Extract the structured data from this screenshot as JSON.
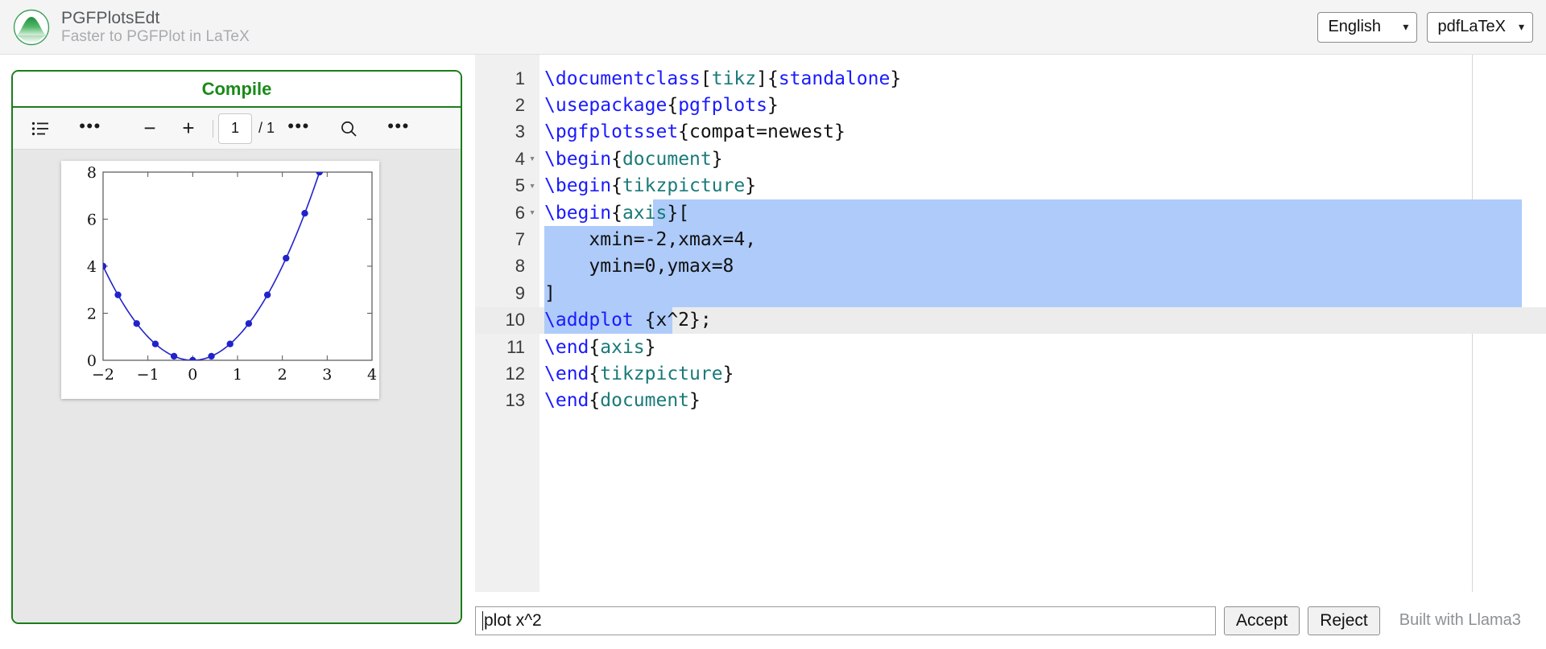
{
  "header": {
    "logo_icon": "pgfplots-peak-logo",
    "title": "PGFPlotsEdt",
    "subtitle": "Faster to PGFPlot in LaTeX",
    "language_select": {
      "value": "English",
      "chevron": "⌄"
    },
    "engine_select": {
      "value": "pdfLaTeX",
      "chevron": "⌄"
    }
  },
  "preview": {
    "compile_label": "Compile",
    "toolbar": {
      "sidebar_toggle_icon": "list-sidebar-icon",
      "view_options_icon": "more-options-icon",
      "zoom_out_label": "−",
      "zoom_in_label": "+",
      "page_number": "1",
      "page_total": "/ 1",
      "page_tools_icon": "more-options-icon",
      "search_icon": "search-icon",
      "overflow_icon": "more-options-icon"
    }
  },
  "chart_data": {
    "type": "line",
    "title": "",
    "xlabel": "",
    "ylabel": "",
    "xlim": [
      -2,
      4
    ],
    "ylim": [
      0,
      8
    ],
    "xticks": [
      -2,
      -1,
      0,
      1,
      2,
      3,
      4
    ],
    "xticklabels": [
      "−2",
      "−1",
      "0",
      "1",
      "2",
      "3",
      "4"
    ],
    "yticks": [
      0,
      2,
      4,
      6,
      8
    ],
    "yticklabels": [
      "0",
      "2",
      "4",
      "6",
      "8"
    ],
    "grid": false,
    "legend": null,
    "series": [
      {
        "name": "x^2",
        "color": "#2222cc",
        "marker": "circle",
        "x": [
          -2,
          -1.667,
          -1.25,
          -0.833,
          -0.417,
          0,
          0.417,
          0.833,
          1.25,
          1.667,
          2.083,
          2.5,
          2.828
        ],
        "y": [
          4,
          2.78,
          1.5625,
          0.694,
          0.174,
          0,
          0.174,
          0.694,
          1.5625,
          2.78,
          4.34,
          6.25,
          8
        ]
      }
    ]
  },
  "editor": {
    "current_line": 10,
    "selection": {
      "from_line": 6,
      "to_line": 10
    },
    "lines": [
      {
        "n": "1",
        "fold": "",
        "sel": false,
        "sel_start": 0,
        "sel_end": 0,
        "tokens": [
          {
            "t": "\\documentclass",
            "c": "k"
          },
          {
            "t": "[",
            "c": "b"
          },
          {
            "t": "tikz",
            "c": "e"
          },
          {
            "t": "]{",
            "c": "b"
          },
          {
            "t": "standalone",
            "c": "k"
          },
          {
            "t": "}",
            "c": "b"
          }
        ]
      },
      {
        "n": "2",
        "fold": "",
        "sel": false,
        "sel_start": 0,
        "sel_end": 0,
        "tokens": [
          {
            "t": "\\usepackage",
            "c": "k"
          },
          {
            "t": "{",
            "c": "b"
          },
          {
            "t": "pgfplots",
            "c": "k"
          },
          {
            "t": "}",
            "c": "b"
          }
        ]
      },
      {
        "n": "3",
        "fold": "",
        "sel": false,
        "sel_start": 0,
        "sel_end": 0,
        "tokens": [
          {
            "t": "\\pgfplotsset",
            "c": "k"
          },
          {
            "t": "{compat=newest}",
            "c": "b"
          }
        ]
      },
      {
        "n": "4",
        "fold": "▾",
        "sel": false,
        "sel_start": 0,
        "sel_end": 0,
        "tokens": [
          {
            "t": "\\begin",
            "c": "k"
          },
          {
            "t": "{",
            "c": "b"
          },
          {
            "t": "document",
            "c": "e"
          },
          {
            "t": "}",
            "c": "b"
          }
        ]
      },
      {
        "n": "5",
        "fold": "▾",
        "sel": false,
        "sel_start": 0,
        "sel_end": 0,
        "tokens": [
          {
            "t": "\\begin",
            "c": "k"
          },
          {
            "t": "{",
            "c": "b"
          },
          {
            "t": "tikzpicture",
            "c": "e"
          },
          {
            "t": "}",
            "c": "b"
          }
        ]
      },
      {
        "n": "6",
        "fold": "▾",
        "sel": true,
        "sel_start": 221,
        "sel_end": 1300,
        "tokens": [
          {
            "t": "\\begin",
            "c": "k"
          },
          {
            "t": "{",
            "c": "b"
          },
          {
            "t": "axis",
            "c": "e"
          },
          {
            "t": "}[",
            "c": "b"
          }
        ]
      },
      {
        "n": "7",
        "fold": "",
        "sel": true,
        "sel_start": 86,
        "sel_end": 1300,
        "tokens": [
          {
            "t": "    xmin=-2,xmax=4,",
            "c": "b"
          }
        ]
      },
      {
        "n": "8",
        "fold": "",
        "sel": true,
        "sel_start": 86,
        "sel_end": 1300,
        "tokens": [
          {
            "t": "    ymin=0,ymax=8",
            "c": "b"
          }
        ]
      },
      {
        "n": "9",
        "fold": "",
        "sel": true,
        "sel_start": 86,
        "sel_end": 1300,
        "tokens": [
          {
            "t": "]",
            "c": "b"
          }
        ]
      },
      {
        "n": "10",
        "fold": "",
        "sel": true,
        "sel_start": 86,
        "sel_end": 245,
        "tokens": [
          {
            "t": "\\addplot",
            "c": "k"
          },
          {
            "t": " {x^2};",
            "c": "b"
          }
        ]
      },
      {
        "n": "11",
        "fold": "",
        "sel": false,
        "sel_start": 0,
        "sel_end": 0,
        "tokens": [
          {
            "t": "\\end",
            "c": "k"
          },
          {
            "t": "{",
            "c": "b"
          },
          {
            "t": "axis",
            "c": "e"
          },
          {
            "t": "}",
            "c": "b"
          }
        ]
      },
      {
        "n": "12",
        "fold": "",
        "sel": false,
        "sel_start": 0,
        "sel_end": 0,
        "tokens": [
          {
            "t": "\\end",
            "c": "k"
          },
          {
            "t": "{",
            "c": "b"
          },
          {
            "t": "tikzpicture",
            "c": "e"
          },
          {
            "t": "}",
            "c": "b"
          }
        ]
      },
      {
        "n": "13",
        "fold": "",
        "sel": false,
        "sel_start": 0,
        "sel_end": 0,
        "tokens": [
          {
            "t": "\\end",
            "c": "k"
          },
          {
            "t": "{",
            "c": "b"
          },
          {
            "t": "document",
            "c": "e"
          },
          {
            "t": "}",
            "c": "b"
          }
        ]
      }
    ]
  },
  "prompt": {
    "value": "plot x^2",
    "placeholder": "",
    "accept_label": "Accept",
    "reject_label": "Reject",
    "built_with": "Built with Llama3"
  },
  "colors": {
    "brand_green": "#1a8a1a",
    "selection_blue": "#aecbfa",
    "plot_blue": "#2222cc",
    "command_blue": "#1a1aff",
    "env_teal": "#1a7a7a"
  }
}
